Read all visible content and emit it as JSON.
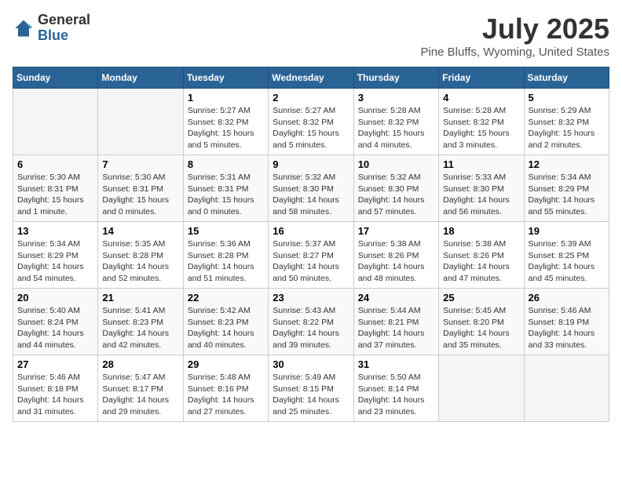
{
  "header": {
    "logo_general": "General",
    "logo_blue": "Blue",
    "title": "July 2025",
    "subtitle": "Pine Bluffs, Wyoming, United States"
  },
  "days_of_week": [
    "Sunday",
    "Monday",
    "Tuesday",
    "Wednesday",
    "Thursday",
    "Friday",
    "Saturday"
  ],
  "weeks": [
    [
      {
        "day": "",
        "empty": true
      },
      {
        "day": "",
        "empty": true
      },
      {
        "day": "1",
        "sunrise": "Sunrise: 5:27 AM",
        "sunset": "Sunset: 8:32 PM",
        "daylight": "Daylight: 15 hours and 5 minutes."
      },
      {
        "day": "2",
        "sunrise": "Sunrise: 5:27 AM",
        "sunset": "Sunset: 8:32 PM",
        "daylight": "Daylight: 15 hours and 5 minutes."
      },
      {
        "day": "3",
        "sunrise": "Sunrise: 5:28 AM",
        "sunset": "Sunset: 8:32 PM",
        "daylight": "Daylight: 15 hours and 4 minutes."
      },
      {
        "day": "4",
        "sunrise": "Sunrise: 5:28 AM",
        "sunset": "Sunset: 8:32 PM",
        "daylight": "Daylight: 15 hours and 3 minutes."
      },
      {
        "day": "5",
        "sunrise": "Sunrise: 5:29 AM",
        "sunset": "Sunset: 8:32 PM",
        "daylight": "Daylight: 15 hours and 2 minutes."
      }
    ],
    [
      {
        "day": "6",
        "sunrise": "Sunrise: 5:30 AM",
        "sunset": "Sunset: 8:31 PM",
        "daylight": "Daylight: 15 hours and 1 minute."
      },
      {
        "day": "7",
        "sunrise": "Sunrise: 5:30 AM",
        "sunset": "Sunset: 8:31 PM",
        "daylight": "Daylight: 15 hours and 0 minutes."
      },
      {
        "day": "8",
        "sunrise": "Sunrise: 5:31 AM",
        "sunset": "Sunset: 8:31 PM",
        "daylight": "Daylight: 15 hours and 0 minutes."
      },
      {
        "day": "9",
        "sunrise": "Sunrise: 5:32 AM",
        "sunset": "Sunset: 8:30 PM",
        "daylight": "Daylight: 14 hours and 58 minutes."
      },
      {
        "day": "10",
        "sunrise": "Sunrise: 5:32 AM",
        "sunset": "Sunset: 8:30 PM",
        "daylight": "Daylight: 14 hours and 57 minutes."
      },
      {
        "day": "11",
        "sunrise": "Sunrise: 5:33 AM",
        "sunset": "Sunset: 8:30 PM",
        "daylight": "Daylight: 14 hours and 56 minutes."
      },
      {
        "day": "12",
        "sunrise": "Sunrise: 5:34 AM",
        "sunset": "Sunset: 8:29 PM",
        "daylight": "Daylight: 14 hours and 55 minutes."
      }
    ],
    [
      {
        "day": "13",
        "sunrise": "Sunrise: 5:34 AM",
        "sunset": "Sunset: 8:29 PM",
        "daylight": "Daylight: 14 hours and 54 minutes."
      },
      {
        "day": "14",
        "sunrise": "Sunrise: 5:35 AM",
        "sunset": "Sunset: 8:28 PM",
        "daylight": "Daylight: 14 hours and 52 minutes."
      },
      {
        "day": "15",
        "sunrise": "Sunrise: 5:36 AM",
        "sunset": "Sunset: 8:28 PM",
        "daylight": "Daylight: 14 hours and 51 minutes."
      },
      {
        "day": "16",
        "sunrise": "Sunrise: 5:37 AM",
        "sunset": "Sunset: 8:27 PM",
        "daylight": "Daylight: 14 hours and 50 minutes."
      },
      {
        "day": "17",
        "sunrise": "Sunrise: 5:38 AM",
        "sunset": "Sunset: 8:26 PM",
        "daylight": "Daylight: 14 hours and 48 minutes."
      },
      {
        "day": "18",
        "sunrise": "Sunrise: 5:38 AM",
        "sunset": "Sunset: 8:26 PM",
        "daylight": "Daylight: 14 hours and 47 minutes."
      },
      {
        "day": "19",
        "sunrise": "Sunrise: 5:39 AM",
        "sunset": "Sunset: 8:25 PM",
        "daylight": "Daylight: 14 hours and 45 minutes."
      }
    ],
    [
      {
        "day": "20",
        "sunrise": "Sunrise: 5:40 AM",
        "sunset": "Sunset: 8:24 PM",
        "daylight": "Daylight: 14 hours and 44 minutes."
      },
      {
        "day": "21",
        "sunrise": "Sunrise: 5:41 AM",
        "sunset": "Sunset: 8:23 PM",
        "daylight": "Daylight: 14 hours and 42 minutes."
      },
      {
        "day": "22",
        "sunrise": "Sunrise: 5:42 AM",
        "sunset": "Sunset: 8:23 PM",
        "daylight": "Daylight: 14 hours and 40 minutes."
      },
      {
        "day": "23",
        "sunrise": "Sunrise: 5:43 AM",
        "sunset": "Sunset: 8:22 PM",
        "daylight": "Daylight: 14 hours and 39 minutes."
      },
      {
        "day": "24",
        "sunrise": "Sunrise: 5:44 AM",
        "sunset": "Sunset: 8:21 PM",
        "daylight": "Daylight: 14 hours and 37 minutes."
      },
      {
        "day": "25",
        "sunrise": "Sunrise: 5:45 AM",
        "sunset": "Sunset: 8:20 PM",
        "daylight": "Daylight: 14 hours and 35 minutes."
      },
      {
        "day": "26",
        "sunrise": "Sunrise: 5:46 AM",
        "sunset": "Sunset: 8:19 PM",
        "daylight": "Daylight: 14 hours and 33 minutes."
      }
    ],
    [
      {
        "day": "27",
        "sunrise": "Sunrise: 5:46 AM",
        "sunset": "Sunset: 8:18 PM",
        "daylight": "Daylight: 14 hours and 31 minutes."
      },
      {
        "day": "28",
        "sunrise": "Sunrise: 5:47 AM",
        "sunset": "Sunset: 8:17 PM",
        "daylight": "Daylight: 14 hours and 29 minutes."
      },
      {
        "day": "29",
        "sunrise": "Sunrise: 5:48 AM",
        "sunset": "Sunset: 8:16 PM",
        "daylight": "Daylight: 14 hours and 27 minutes."
      },
      {
        "day": "30",
        "sunrise": "Sunrise: 5:49 AM",
        "sunset": "Sunset: 8:15 PM",
        "daylight": "Daylight: 14 hours and 25 minutes."
      },
      {
        "day": "31",
        "sunrise": "Sunrise: 5:50 AM",
        "sunset": "Sunset: 8:14 PM",
        "daylight": "Daylight: 14 hours and 23 minutes."
      },
      {
        "day": "",
        "empty": true
      },
      {
        "day": "",
        "empty": true
      }
    ]
  ]
}
